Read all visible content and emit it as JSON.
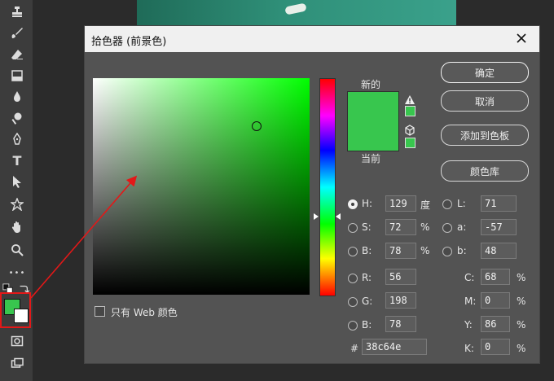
{
  "dialog": {
    "title": "拾色器 (前景色)",
    "label_new": "新的",
    "label_current": "当前",
    "only_web": "只有 Web 颜色"
  },
  "buttons": {
    "ok": "确定",
    "cancel": "取消",
    "add_swatch": "添加到色板",
    "color_libraries": "颜色库"
  },
  "fields": {
    "H": {
      "label": "H:",
      "value": "129",
      "unit": "度"
    },
    "S": {
      "label": "S:",
      "value": "72",
      "unit": "%"
    },
    "B": {
      "label": "B:",
      "value": "78",
      "unit": "%"
    },
    "R": {
      "label": "R:",
      "value": "56"
    },
    "G": {
      "label": "G:",
      "value": "198"
    },
    "Bl": {
      "label": "B:",
      "value": "78"
    },
    "L": {
      "label": "L:",
      "value": "71"
    },
    "a": {
      "label": "a:",
      "value": "-57"
    },
    "b": {
      "label": "b:",
      "value": "48"
    },
    "C": {
      "label": "C:",
      "value": "68",
      "unit": "%"
    },
    "M": {
      "label": "M:",
      "value": "0",
      "unit": "%"
    },
    "Y": {
      "label": "Y:",
      "value": "86",
      "unit": "%"
    },
    "K": {
      "label": "K:",
      "value": "0",
      "unit": "%"
    },
    "hex": {
      "label": "#",
      "value": "38c64e"
    }
  },
  "colors": {
    "selected": "#38c64e",
    "accent_red": "#e31818"
  },
  "tools": [
    "stamp-icon",
    "brush-icon",
    "eraser-icon",
    "gradient-icon",
    "blur-icon",
    "dodge-icon",
    "pen-icon",
    "text-icon",
    "path-select-icon",
    "shape-icon",
    "hand-icon",
    "zoom-icon",
    "more-icon",
    "quickmask-icon",
    "screenmode-icon"
  ],
  "tool_text": {
    "type_tool": "T",
    "more": "•••"
  }
}
